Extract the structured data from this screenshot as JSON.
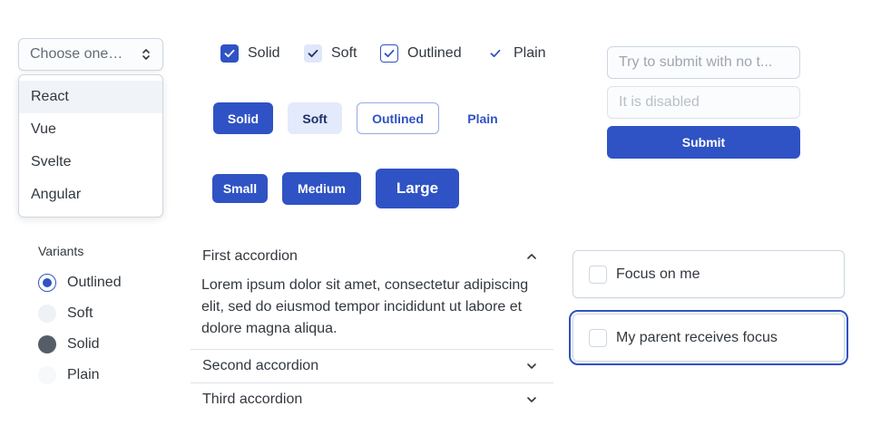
{
  "select": {
    "placeholder": "Choose one…",
    "options": [
      "React",
      "Vue",
      "Svelte",
      "Angular"
    ],
    "icon": "select-chevrons-icon"
  },
  "checkboxes": [
    {
      "label": "Solid",
      "variant": "solid",
      "checked": true
    },
    {
      "label": "Soft",
      "variant": "soft",
      "checked": true
    },
    {
      "label": "Outlined",
      "variant": "outlined",
      "checked": true
    },
    {
      "label": "Plain",
      "variant": "plain",
      "checked": true
    }
  ],
  "variant_buttons": {
    "solid": "Solid",
    "soft": "Soft",
    "outlined": "Outlined",
    "plain": "Plain"
  },
  "size_buttons": {
    "small": "Small",
    "medium": "Medium",
    "large": "Large"
  },
  "form": {
    "input_placeholder": "Try to submit with no t...",
    "disabled_placeholder": "It is disabled",
    "submit": "Submit"
  },
  "radio_group": {
    "title": "Variants",
    "options": [
      {
        "label": "Outlined",
        "variant": "outlined",
        "checked": true
      },
      {
        "label": "Soft",
        "variant": "soft",
        "checked": false
      },
      {
        "label": "Solid",
        "variant": "solid",
        "checked": false
      },
      {
        "label": "Plain",
        "variant": "plain",
        "checked": false
      }
    ]
  },
  "accordion": {
    "items": [
      {
        "title": "First accordion",
        "expanded": true,
        "body": "Lorem ipsum dolor sit amet, consectetur adipiscing elit, sed do eiusmod tempor incididunt ut labore et dolore magna aliqua."
      },
      {
        "title": "Second accordion",
        "expanded": false
      },
      {
        "title": "Third accordion",
        "expanded": false
      }
    ]
  },
  "focus_cards": {
    "first": "Focus on me",
    "second": "My parent receives focus"
  },
  "colors": {
    "primary": "#2f53c4",
    "text": "#32383e",
    "border": "#cdd7e1"
  }
}
